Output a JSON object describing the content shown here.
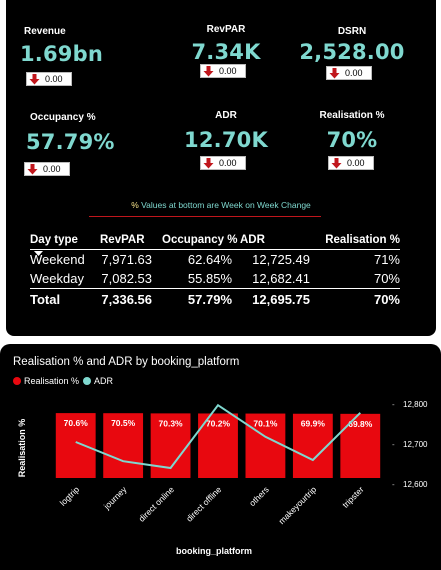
{
  "kpis": [
    {
      "label": "Revenue",
      "value": "1.69bn",
      "change": "0.00"
    },
    {
      "label": "RevPAR",
      "value": "7.34K",
      "change": "0.00"
    },
    {
      "label": "DSRN",
      "value": "2,528.00",
      "change": "0.00"
    },
    {
      "label": "Occupancy %",
      "value": "57.79%",
      "change": "0.00"
    },
    {
      "label": "ADR",
      "value": "12.70K",
      "change": "0.00"
    },
    {
      "label": "Realisation %",
      "value": "70%",
      "change": "0.00"
    }
  ],
  "note": {
    "pct": "%",
    "rest": " Values at bottom are Week on Week Change"
  },
  "table": {
    "headers": [
      "Day type",
      "RevPAR",
      "Occupancy %",
      "ADR",
      "Realisation %"
    ],
    "rows": [
      [
        "Weekend",
        "7,971.63",
        "62.64%",
        "12,725.49",
        "71%"
      ],
      [
        "Weekday",
        "7,082.53",
        "55.85%",
        "12,682.41",
        "70%"
      ]
    ],
    "total": [
      "Total",
      "7,336.56",
      "57.79%",
      "12,695.75",
      "70%"
    ]
  },
  "colors": {
    "accent": "#7fd8cf",
    "bar": "#e8080f",
    "down_arrow": "#c0161c",
    "line": "#7fd8cf"
  },
  "chart_title": "Realisation % and ADR by booking_platform",
  "chart_data": {
    "type": "bar",
    "title": "Realisation % and ADR by booking_platform",
    "xlabel": "booking_platform",
    "ylabel": "Realisation %",
    "categories": [
      "logtrip",
      "journey",
      "direct online",
      "direct offline",
      "others",
      "makeyourtrip",
      "tripster"
    ],
    "series": [
      {
        "name": "Realisation %",
        "type": "bar",
        "values": [
          70.6,
          70.5,
          70.3,
          70.2,
          70.1,
          69.9,
          69.8
        ],
        "labels": [
          "70.6%",
          "70.5%",
          "70.3%",
          "70.2%",
          "70.1%",
          "69.9%",
          "69.8%"
        ]
      },
      {
        "name": "ADR",
        "type": "line",
        "axis": "right",
        "values": [
          12705,
          12657,
          12640,
          12797,
          12718,
          12660,
          12778
        ]
      }
    ],
    "y2_ticks": [
      "12,600",
      "12,700",
      "12,800"
    ],
    "y2lim": [
      12580,
      12820
    ],
    "legend": "top-left",
    "grid": false
  }
}
